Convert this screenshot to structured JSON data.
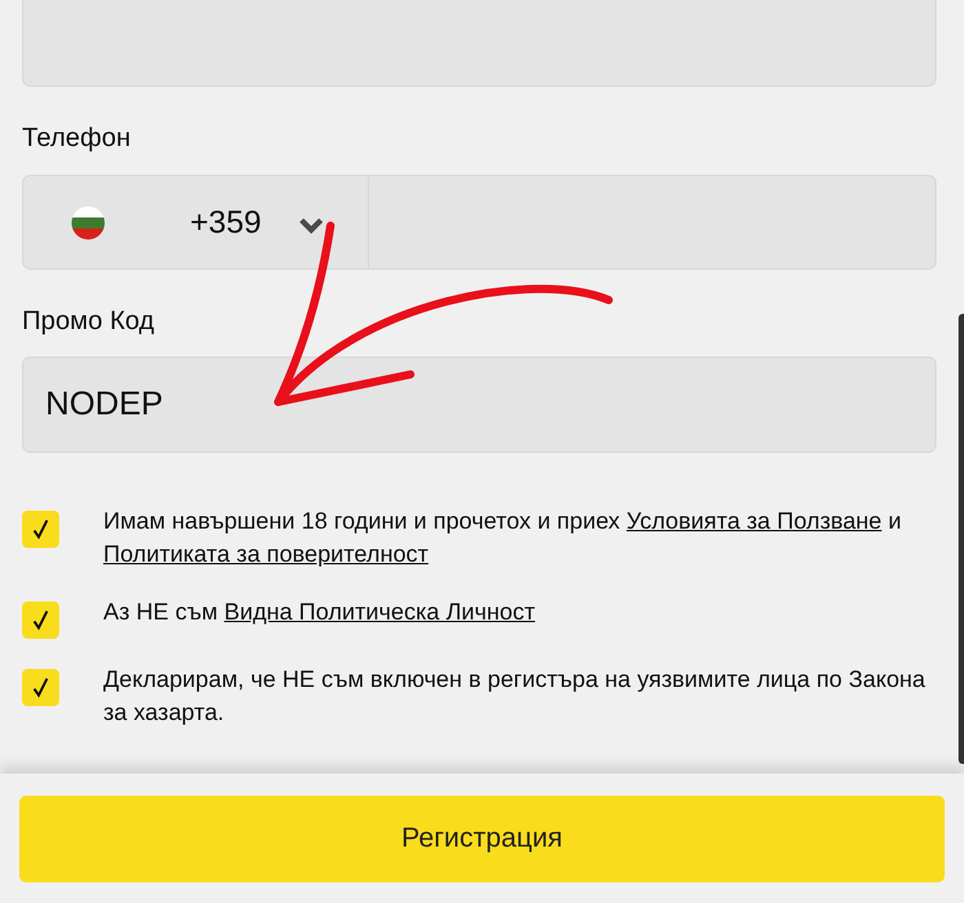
{
  "phone": {
    "label": "Телефон",
    "country_code": "+359"
  },
  "promo": {
    "label": "Промо Код",
    "value": "NODEP"
  },
  "consents": [
    {
      "checked": true,
      "parts": [
        {
          "text": "Имам навършени 18 години и прочетох и приех "
        },
        {
          "link": "Условията за Ползване"
        },
        {
          "text": " и "
        },
        {
          "link": "Политиката за поверителност"
        }
      ]
    },
    {
      "checked": true,
      "parts": [
        {
          "text": "Аз НЕ съм "
        },
        {
          "link": "Видна Политическа Личност"
        }
      ]
    },
    {
      "checked": true,
      "parts": [
        {
          "text": "Декларирам, че НЕ съм включен в регистъра на уязвимите лица по Закона за хазарта."
        }
      ]
    }
  ],
  "submit": "Регистрация"
}
